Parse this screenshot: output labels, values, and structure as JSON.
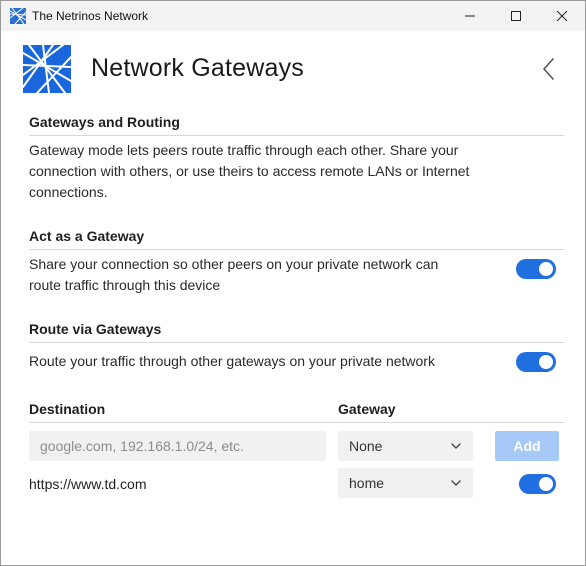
{
  "window": {
    "title": "The Netrinos Network"
  },
  "header": {
    "title": "Network Gateways",
    "back_icon": "chevron-left-icon"
  },
  "sections": {
    "gateways_routing": {
      "title": "Gateways and Routing",
      "description_lines": [
        "Gateway mode lets peers route traffic through each other. Share your",
        "connection with others, or use theirs to access remote LANs or Internet",
        "connections."
      ]
    },
    "act_as_gateway": {
      "title": "Act as a Gateway",
      "description_lines": [
        "Share your connection so other peers on your private network can",
        "route traffic through this device"
      ],
      "enabled": true
    },
    "route_via_gateways": {
      "title": "Route via Gateways",
      "description": "Route your traffic through other gateways on your private network",
      "enabled": true
    }
  },
  "routes_table": {
    "columns": [
      "Destination",
      "Gateway"
    ],
    "new_route": {
      "destination_placeholder": "google.com, 192.168.1.0/24, etc.",
      "destination_value": "",
      "gateway_selected": "None",
      "add_label": "Add"
    },
    "rows": [
      {
        "destination": "https://www.td.com",
        "gateway": "home",
        "enabled": true
      }
    ]
  },
  "colors": {
    "accent": "#1f6fe0",
    "add_button_disabled": "#a7c9f7",
    "input_bg": "#f1f1f1"
  }
}
